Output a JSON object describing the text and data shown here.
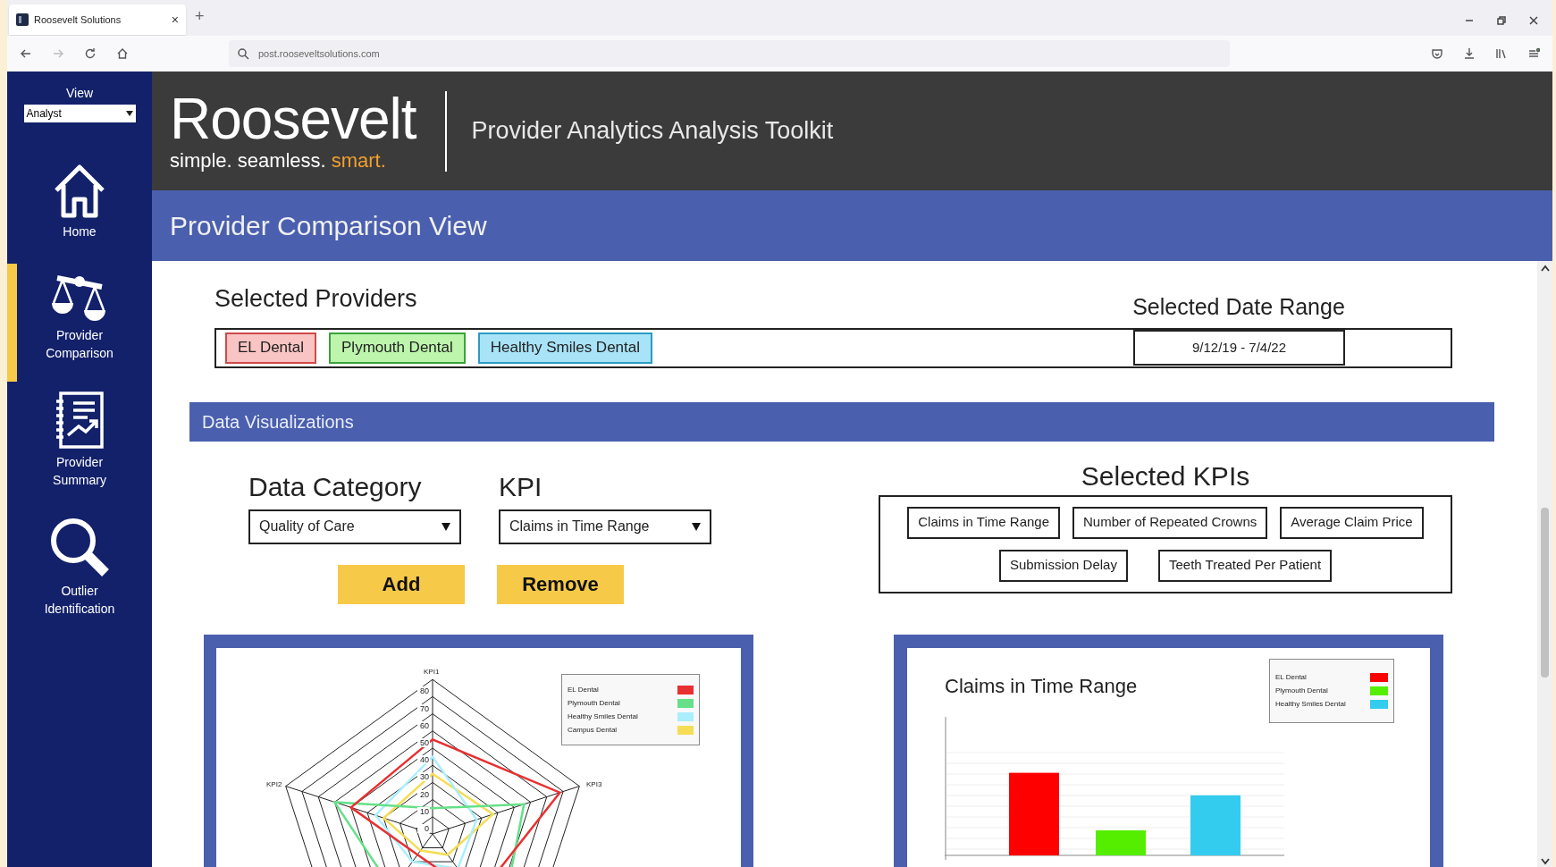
{
  "browser": {
    "tab_title": "Roosevelt Solutions",
    "tab_close": "×",
    "new_tab": "+",
    "url": "post.rooseveltsolutions.com"
  },
  "sidebar": {
    "view_label": "View",
    "view_value": "Analyst",
    "items": [
      {
        "label": "Home",
        "kind": "home",
        "selected": false
      },
      {
        "label": "Provider Comparison",
        "kind": "scales",
        "selected": true
      },
      {
        "label": "Provider Summary",
        "kind": "report",
        "selected": false
      },
      {
        "label": "Outlier Identification",
        "kind": "search",
        "selected": false
      }
    ]
  },
  "header": {
    "logo_name": "Roosevelt",
    "logo_tagline": [
      {
        "text": "simple.",
        "highlight": false
      },
      {
        "text": "seamless.",
        "highlight": false
      },
      {
        "text": "smart.",
        "highlight": true
      }
    ],
    "app_title": "Provider Analytics Analysis Toolkit"
  },
  "page_title": "Provider Comparison View",
  "selected_providers": {
    "title": "Selected Providers",
    "providers": [
      {
        "name": "EL Dental",
        "color": "#f9c4c4"
      },
      {
        "name": "Plymouth Dental",
        "color": "#bdf5ad"
      },
      {
        "name": "Healthy Smiles Dental",
        "color": "#a9e3f7"
      }
    ]
  },
  "date_range": {
    "title": "Selected Date Range",
    "value": "9/12/19 - 7/4/22"
  },
  "data_visualizations": {
    "title": "Data Visualizations",
    "data_category": {
      "label": "Data Category",
      "value": "Quality of Care"
    },
    "kpi": {
      "label": "KPI",
      "value": "Claims in Time Range"
    },
    "buttons": [
      "Add",
      "Remove"
    ],
    "selected_kpis": {
      "title": "Selected KPIs",
      "items": [
        "Claims in Time Range",
        "Number of Repeated Crowns",
        "Average Claim Price",
        "Submission Delay",
        "Teeth Treated Per Patient"
      ]
    },
    "radar": {
      "axis_labels": [
        "KPI1",
        "KPI2",
        "KPI3"
      ],
      "ticks": [
        "80",
        "70",
        "60",
        "50",
        "40",
        "30",
        "20",
        "10",
        "0"
      ],
      "legend": [
        {
          "name": "EL Dental",
          "color": "#e83030"
        },
        {
          "name": "Plymouth Dental",
          "color": "#66e088"
        },
        {
          "name": "Healthy Smiles Dental",
          "color": "#aaeeff"
        },
        {
          "name": "Campus Dental",
          "color": "#f5dd55"
        }
      ]
    },
    "bar": {
      "title": "Claims in Time Range",
      "legend": [
        {
          "name": "EL Dental",
          "color": "#ff0000"
        },
        {
          "name": "Plymouth Dental",
          "color": "#55ee00"
        },
        {
          "name": "Healthy Smiles Dental",
          "color": "#33ccee"
        }
      ]
    }
  }
}
